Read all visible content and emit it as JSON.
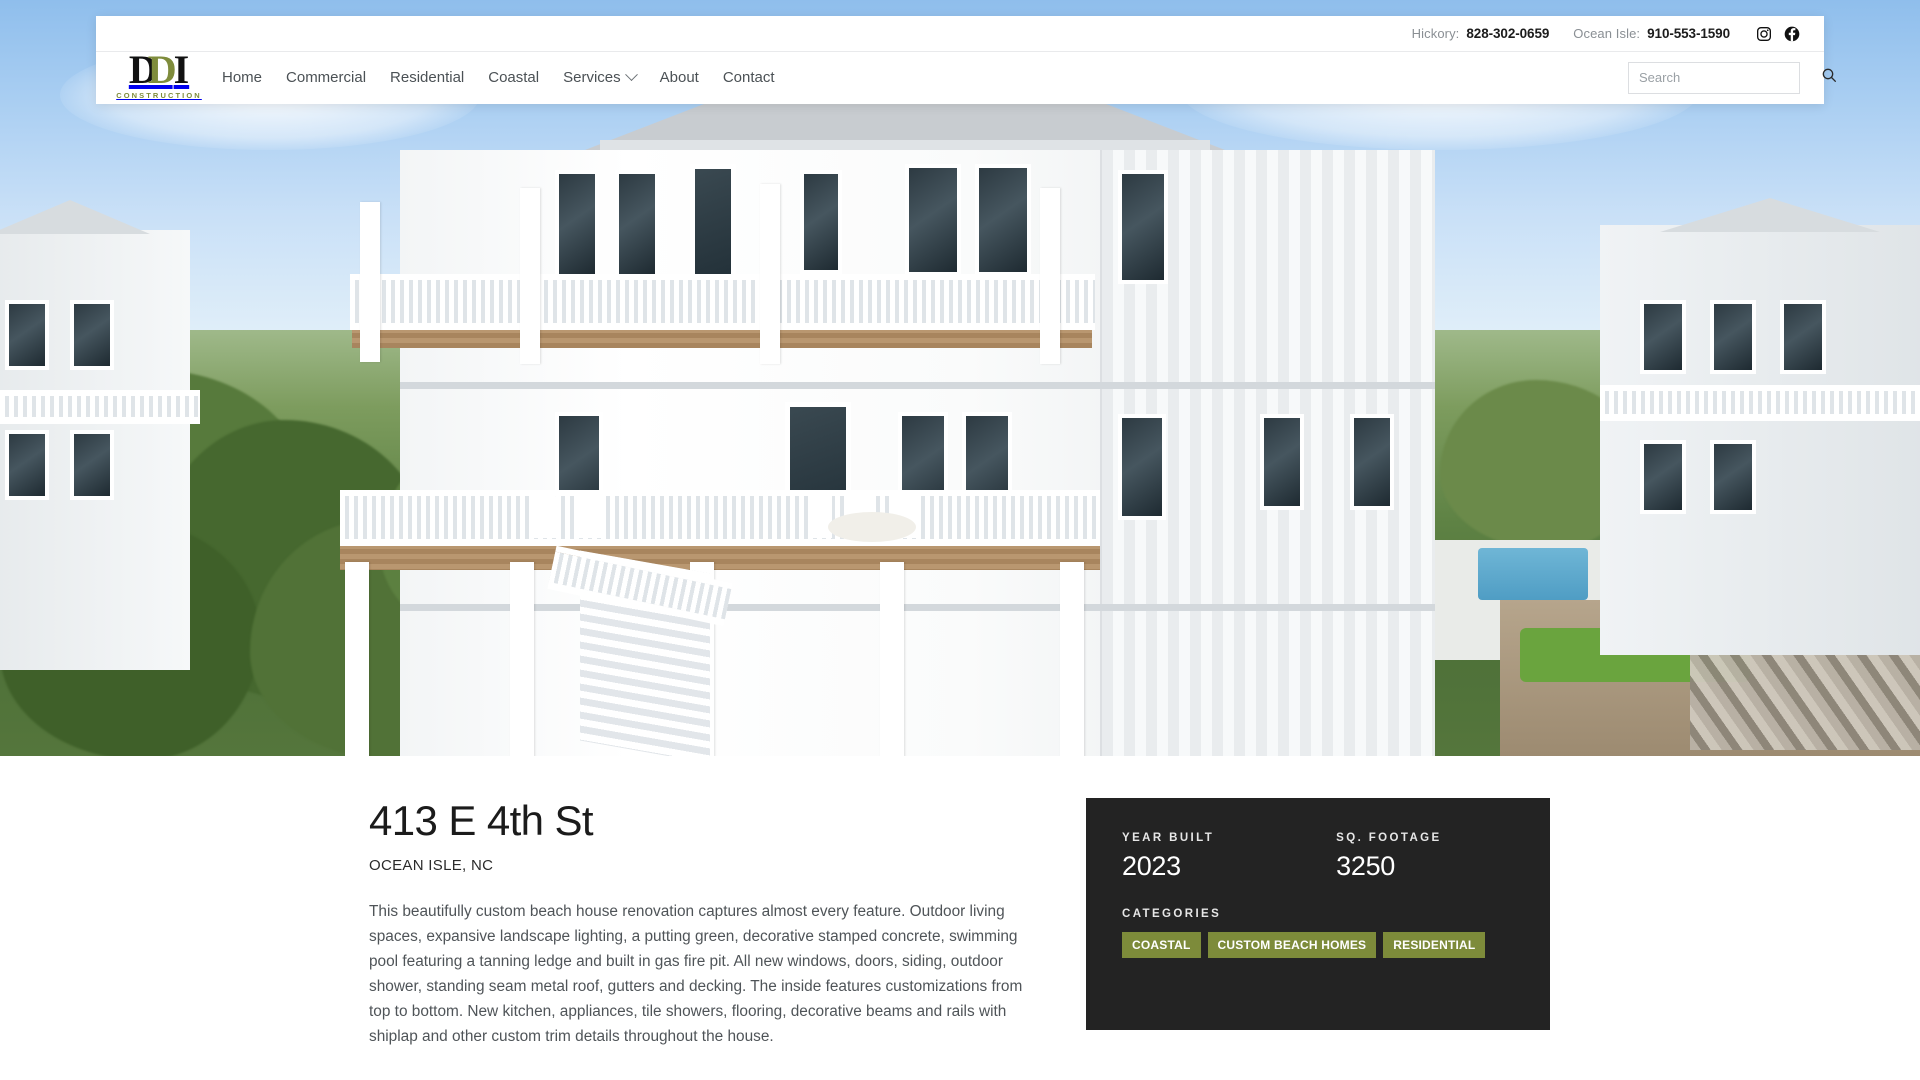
{
  "topbar": {
    "contacts": [
      {
        "label": "Hickory:",
        "number": "828-302-0659"
      },
      {
        "label": "Ocean Isle:",
        "number": "910-553-1590"
      }
    ],
    "social": [
      {
        "name": "instagram-icon"
      },
      {
        "name": "facebook-icon"
      }
    ]
  },
  "logo": {
    "letter_one": "D",
    "letter_two": "D",
    "letter_three": "I",
    "subtitle": "CONSTRUCTION",
    "accent_color": "#7f8c3c"
  },
  "nav": {
    "items": [
      {
        "label": "Home",
        "has_dropdown": false
      },
      {
        "label": "Commercial",
        "has_dropdown": false
      },
      {
        "label": "Residential",
        "has_dropdown": false
      },
      {
        "label": "Coastal",
        "has_dropdown": false
      },
      {
        "label": "Services",
        "has_dropdown": true
      },
      {
        "label": "About",
        "has_dropdown": false
      },
      {
        "label": "Contact",
        "has_dropdown": false
      }
    ]
  },
  "search": {
    "placeholder": "Search",
    "value": "",
    "icon": "search-icon"
  },
  "hero": {
    "alt": "Aerial photo of a white three-story coastal beach house with wrap-around porches and railings"
  },
  "project": {
    "title": "413 E 4th St",
    "location": "OCEAN ISLE, NC",
    "description": "This beautifully custom beach house renovation captures almost every feature. Outdoor living spaces, expansive landscape lighting, a putting green, decorative stamped concrete, swimming pool featuring a tanning ledge and built in gas fire pit. All new windows, doors, siding, outdoor shower, standing seam metal roof, gutters and decking. The inside features customizations from top to bottom. New kitchen, appliances, tile showers, flooring, decorative beams and rails with shiplap and other custom trim details throughout the house."
  },
  "info_card": {
    "background_color": "#232323",
    "year_built_label": "YEAR BUILT",
    "year_built_value": "2023",
    "sq_footage_label": "SQ. FOOTAGE",
    "sq_footage_value": "3250",
    "categories_label": "CATEGORIES",
    "badge_color": "#7d8b3a",
    "categories": [
      {
        "label": "COASTAL"
      },
      {
        "label": "CUSTOM BEACH HOMES"
      },
      {
        "label": "RESIDENTIAL"
      }
    ]
  }
}
